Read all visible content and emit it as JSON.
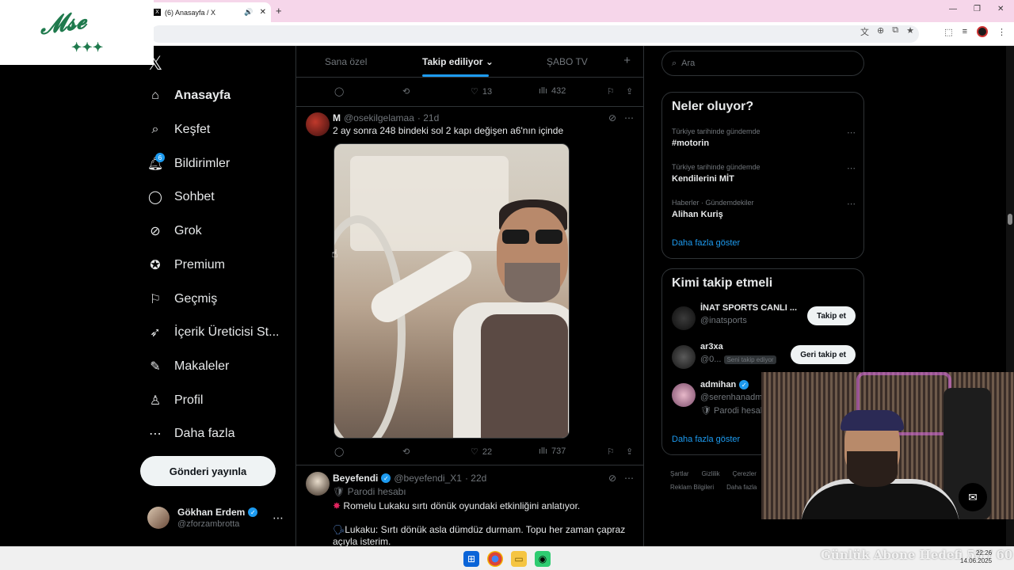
{
  "browser": {
    "tab_count": "(6)",
    "tab_title": "(6) Anasayfa / X",
    "new_tab": "+",
    "favicon": "X"
  },
  "nav": {
    "items": [
      {
        "label": "Anasayfa",
        "icon": "home-icon"
      },
      {
        "label": "Keşfet",
        "icon": "search-icon"
      },
      {
        "label": "Bildirimler",
        "icon": "bell-icon",
        "badge": "6"
      },
      {
        "label": "Sohbet",
        "icon": "chat-icon"
      },
      {
        "label": "Grok",
        "icon": "grok-icon"
      },
      {
        "label": "Premium",
        "icon": "premium-icon"
      },
      {
        "label": "Geçmiş",
        "icon": "bookmark-icon"
      },
      {
        "label": "İçerik Üreticisi St...",
        "icon": "rocket-icon"
      },
      {
        "label": "Makaleler",
        "icon": "article-icon"
      },
      {
        "label": "Profil",
        "icon": "profile-icon"
      },
      {
        "label": "Daha fazla",
        "icon": "more-circle-icon"
      }
    ],
    "post_button": "Gönderi yayınla",
    "me": {
      "name": "Gökhan Erdem",
      "handle": "@zforzambrotta"
    }
  },
  "timeline": {
    "tabs": [
      "Sana özel",
      "Takip ediliyor",
      "ŞABO TV"
    ],
    "top_actions": {
      "likes": "13",
      "views": "432"
    },
    "tweet1": {
      "name": "M",
      "handle": "@osekilgelamaa",
      "time": "· 21d",
      "text": "2 ay sonra 248 bindeki sol 2 kapı değişen a6'nın içinde",
      "likes": "22",
      "views": "737"
    },
    "tweet2": {
      "name": "Beyefendi",
      "handle": "@beyefendi_X1",
      "time": "· 22d",
      "parody": "Parodi hesabı",
      "line1": "Romelu Lukaku sırtı dönük oyundaki etkinliğini anlatıyor.",
      "line2": "Lukaku: Sırtı dönük asla dümdüz durmam. Topu her zaman çapraz açıyla isterim."
    }
  },
  "right": {
    "search_placeholder": "Ara",
    "trends_title": "Neler oluyor?",
    "trends": [
      {
        "category": "Türkiye tarihinde gündemde",
        "title": "#motorin"
      },
      {
        "category": "Türkiye tarihinde gündemde",
        "title": "Kendilerini MİT"
      },
      {
        "category": "Haberler · Gündemdekiler",
        "title": "Alihan Kuriş"
      }
    ],
    "show_more": "Daha fazla göster",
    "who_title": "Kimi takip etmeli",
    "who": [
      {
        "name": "İNAT SPORTS CANLI ...",
        "handle": "@inatsports",
        "button": "Takip et"
      },
      {
        "name": "ar3xa",
        "handle": "@0...",
        "tag": "Seni takip ediyor",
        "button": "Geri takip et"
      },
      {
        "name": "admihan",
        "handle": "@serenhanadm",
        "sub": "Parodi hesab"
      }
    ],
    "show_more2": "Daha fazla göster",
    "footer": [
      "Şartlar",
      "Gizlilik",
      "Çerezler",
      "Reklam Bilgileri",
      "Daha fazla"
    ]
  },
  "overlay": {
    "ticker": "Günlük Abone Hedefi 55 / 60",
    "clock_time": "22:26",
    "clock_date": "14.06.2025"
  },
  "colors": {
    "accent": "#1d9bf0",
    "background": "#000000",
    "text": "#e7e9ea",
    "muted": "#71767b",
    "tabbar": "#f6d6ea"
  }
}
